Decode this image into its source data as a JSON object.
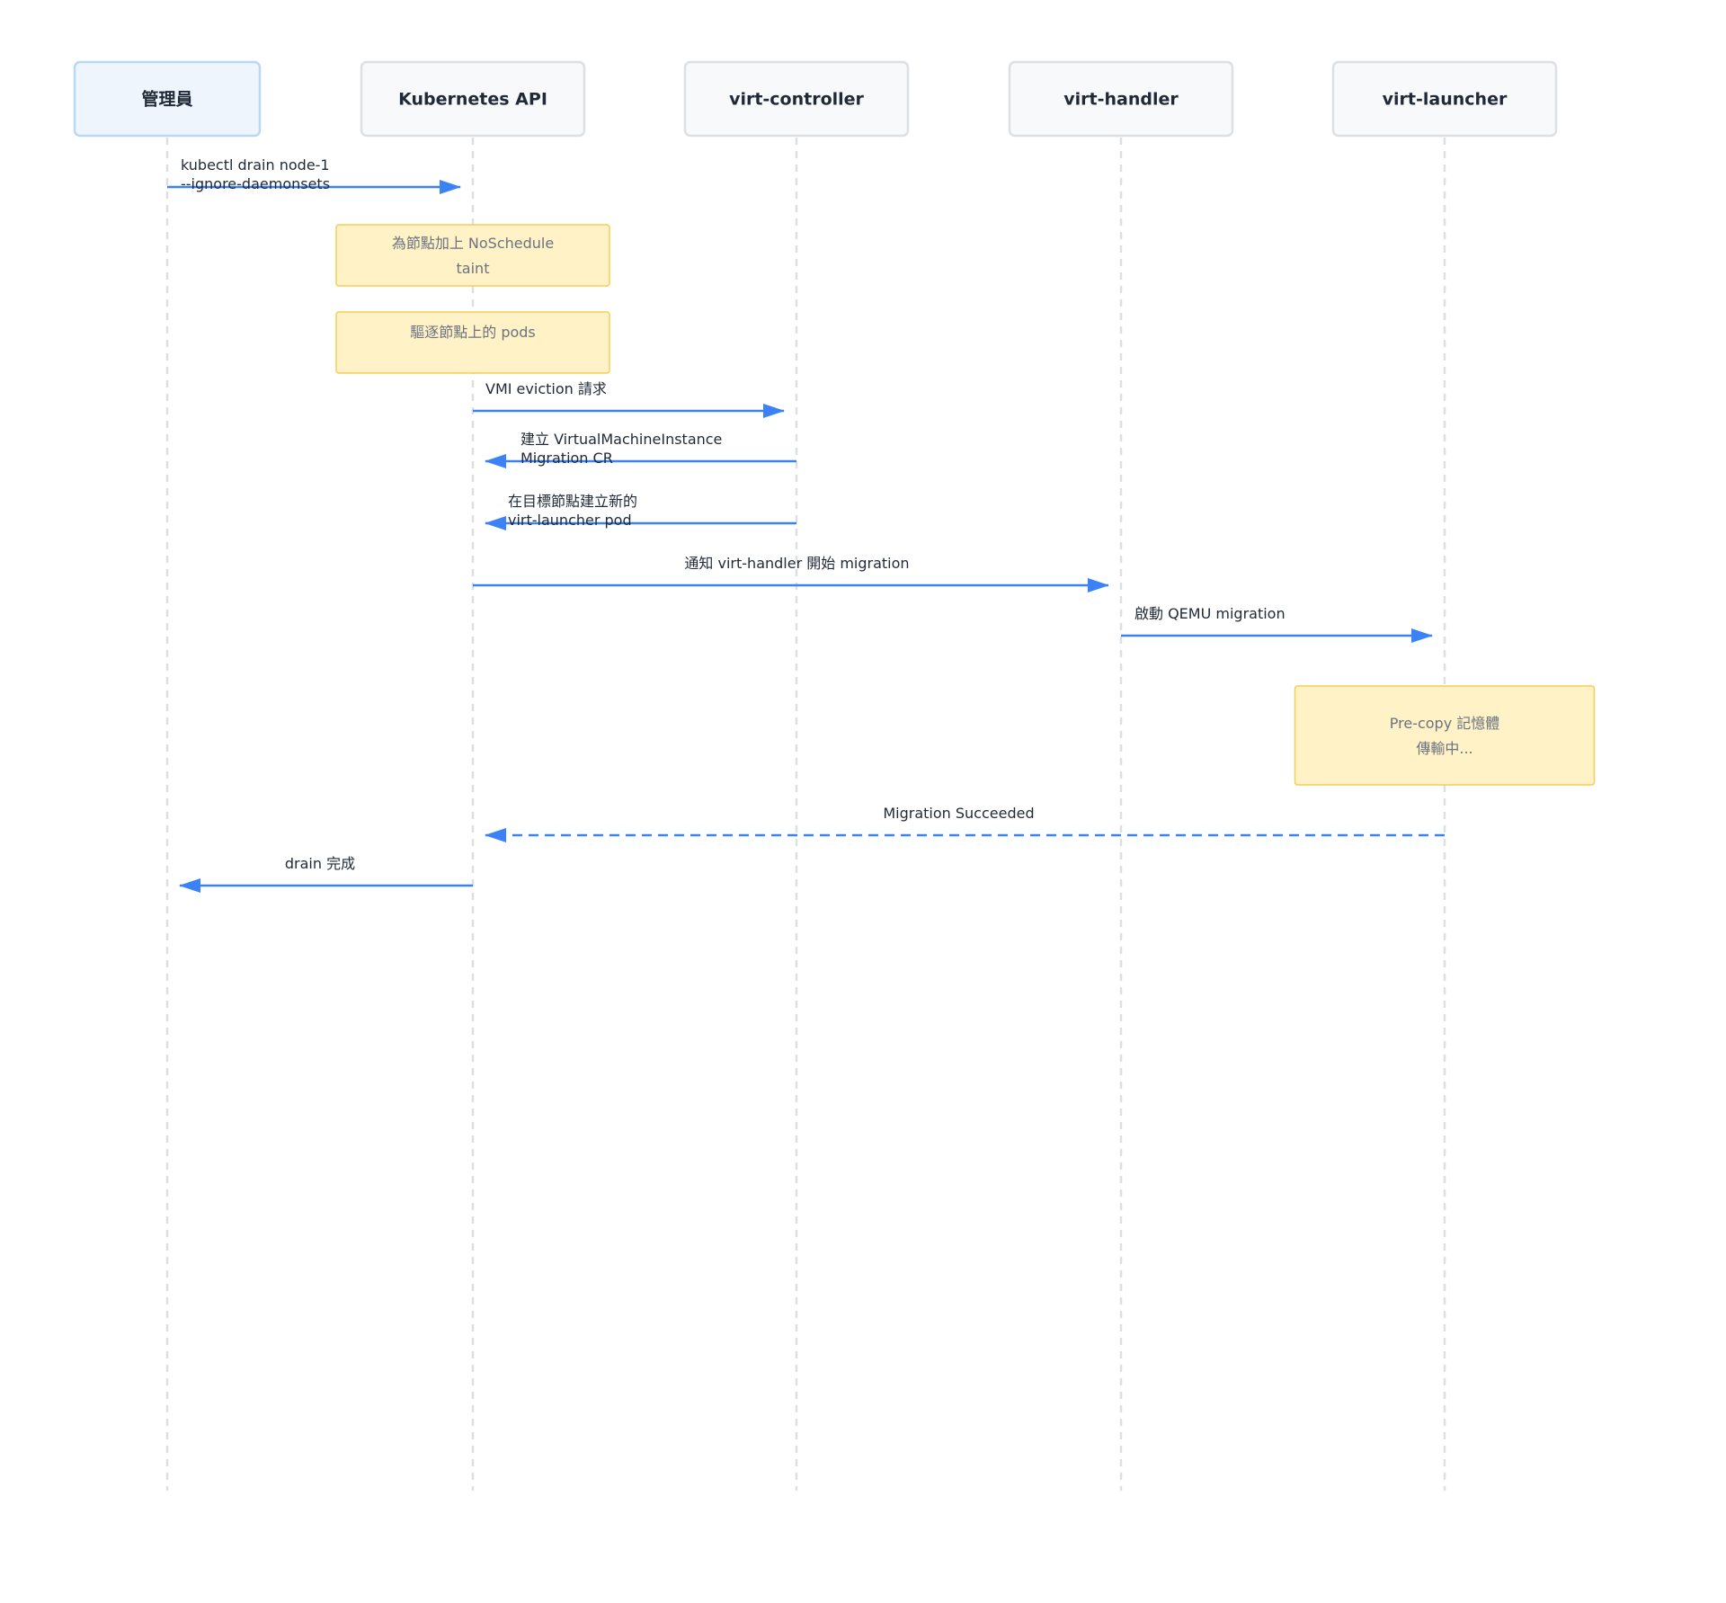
{
  "participants": [
    {
      "id": "admin",
      "label": "管理員",
      "highlight": true
    },
    {
      "id": "k8s",
      "label": "Kubernetes API",
      "highlight": false
    },
    {
      "id": "controller",
      "label": "virt-controller",
      "highlight": false
    },
    {
      "id": "handler",
      "label": "virt-handler",
      "highlight": false
    },
    {
      "id": "launcher",
      "label": "virt-launcher",
      "highlight": false
    }
  ],
  "steps": [
    {
      "kind": "message",
      "from": "admin",
      "to": "k8s",
      "style": "solid",
      "lines": [
        "kubectl drain node-1",
        "--ignore-daemonsets"
      ]
    },
    {
      "kind": "note",
      "over": "k8s",
      "lines": [
        "為節點加上 NoSchedule",
        "taint"
      ]
    },
    {
      "kind": "note",
      "over": "k8s",
      "lines": [
        "驅逐節點上的 pods"
      ]
    },
    {
      "kind": "message",
      "from": "k8s",
      "to": "controller",
      "style": "solid",
      "lines": [
        "VMI eviction 請求"
      ]
    },
    {
      "kind": "message",
      "from": "controller",
      "to": "k8s",
      "style": "solid",
      "lines": [
        "建立 VirtualMachineInstance",
        "Migration CR"
      ]
    },
    {
      "kind": "message",
      "from": "controller",
      "to": "k8s",
      "style": "solid",
      "lines": [
        "在目標節點建立新的",
        "virt-launcher pod"
      ]
    },
    {
      "kind": "message",
      "from": "k8s",
      "to": "handler",
      "style": "solid",
      "lines": [
        "通知 virt-handler 開始 migration"
      ]
    },
    {
      "kind": "message",
      "from": "handler",
      "to": "launcher",
      "style": "solid",
      "lines": [
        "啟動 QEMU migration"
      ]
    },
    {
      "kind": "note",
      "over": "launcher",
      "lines": [
        "Pre-copy 記憶體",
        "傳輸中..."
      ]
    },
    {
      "kind": "message",
      "from": "launcher",
      "to": "k8s",
      "style": "dashed",
      "lines": [
        "Migration Succeeded"
      ]
    },
    {
      "kind": "message",
      "from": "k8s",
      "to": "admin",
      "style": "solid",
      "lines": [
        "drain 完成"
      ]
    }
  ],
  "colors": {
    "arrow": "#3b82f6",
    "note_fill": "#fff2c7",
    "note_border": "#f7cd55",
    "lifeline": "#dcdfe3"
  }
}
